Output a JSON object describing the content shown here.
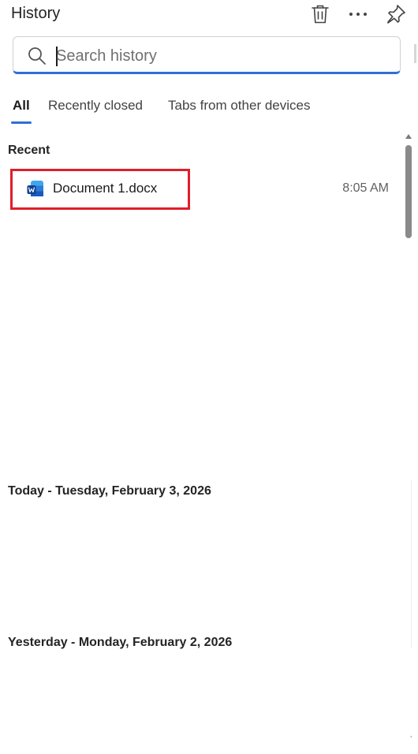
{
  "header": {
    "title": "History"
  },
  "search": {
    "placeholder": "Search history",
    "value": ""
  },
  "tabs": [
    {
      "label": "All",
      "selected": true
    },
    {
      "label": "Recently closed",
      "selected": false
    },
    {
      "label": "Tabs from other devices",
      "selected": false
    }
  ],
  "sections": {
    "recent": {
      "heading": "Recent",
      "items": [
        {
          "title": "Document 1.docx",
          "time": "8:05 AM",
          "icon": "word-icon"
        }
      ]
    },
    "today": {
      "heading": "Today - Tuesday, February 3, 2026"
    },
    "yesterday": {
      "heading": "Yesterday - Monday, February 2, 2026"
    }
  },
  "colors": {
    "accent": "#2f6fd6",
    "highlight": "#e01e2a"
  }
}
